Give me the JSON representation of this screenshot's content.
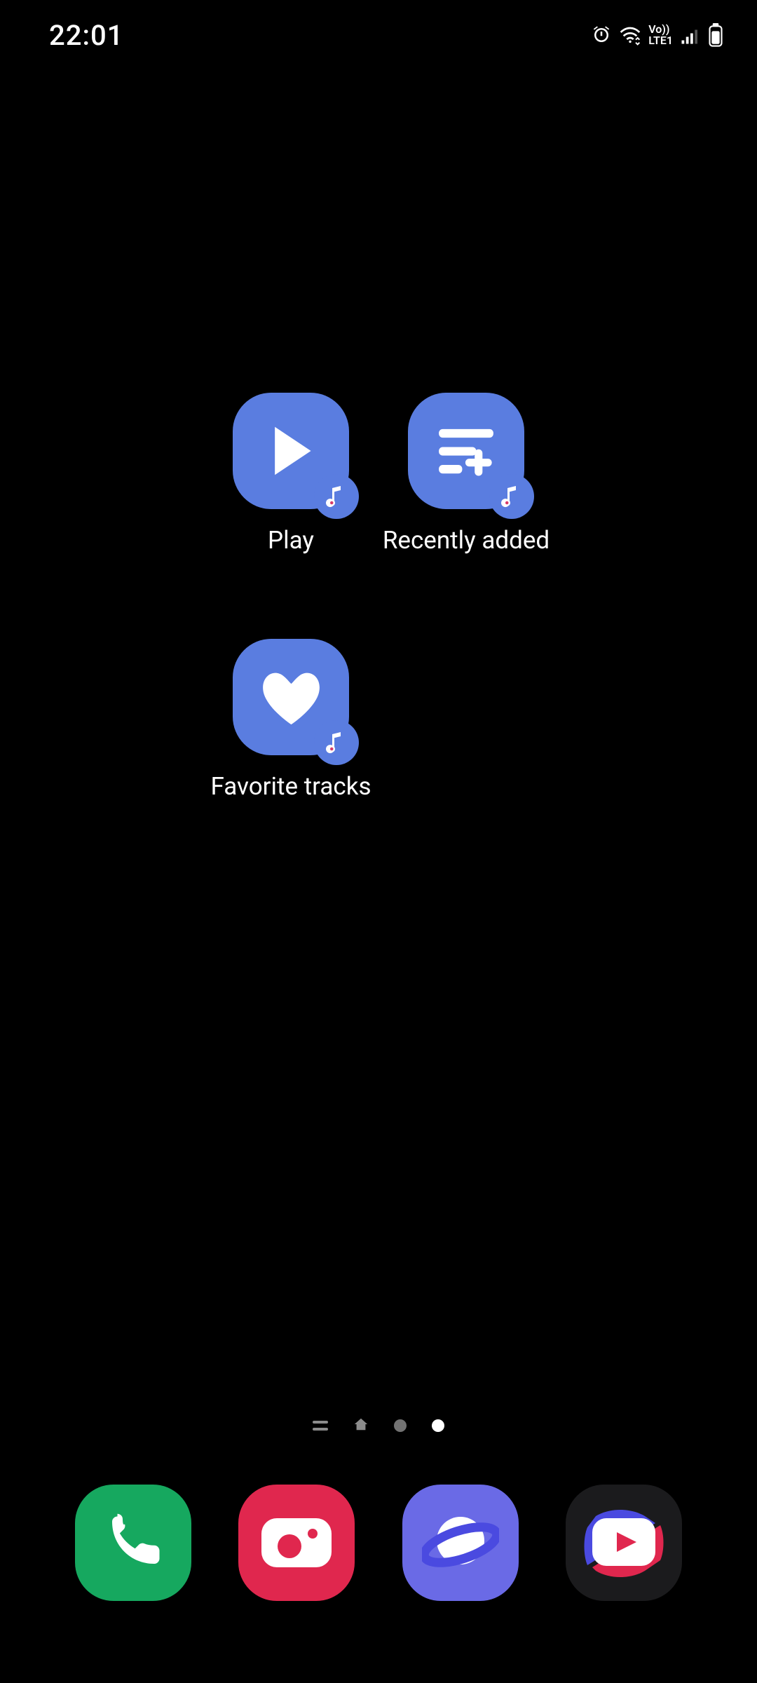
{
  "status_bar": {
    "time": "22:01",
    "network_label": "LTE1",
    "vo_label": "Vo))"
  },
  "shortcuts": {
    "play": {
      "label": "Play"
    },
    "recent": {
      "label": "Recently added"
    },
    "fav": {
      "label": "Favorite tracks"
    }
  },
  "page_indicator": {
    "total_pages": 2,
    "active_index": 1
  },
  "dock": {
    "phone": {
      "name": "phone"
    },
    "camera": {
      "name": "camera"
    },
    "browser": {
      "name": "browser"
    },
    "video": {
      "name": "video"
    }
  }
}
